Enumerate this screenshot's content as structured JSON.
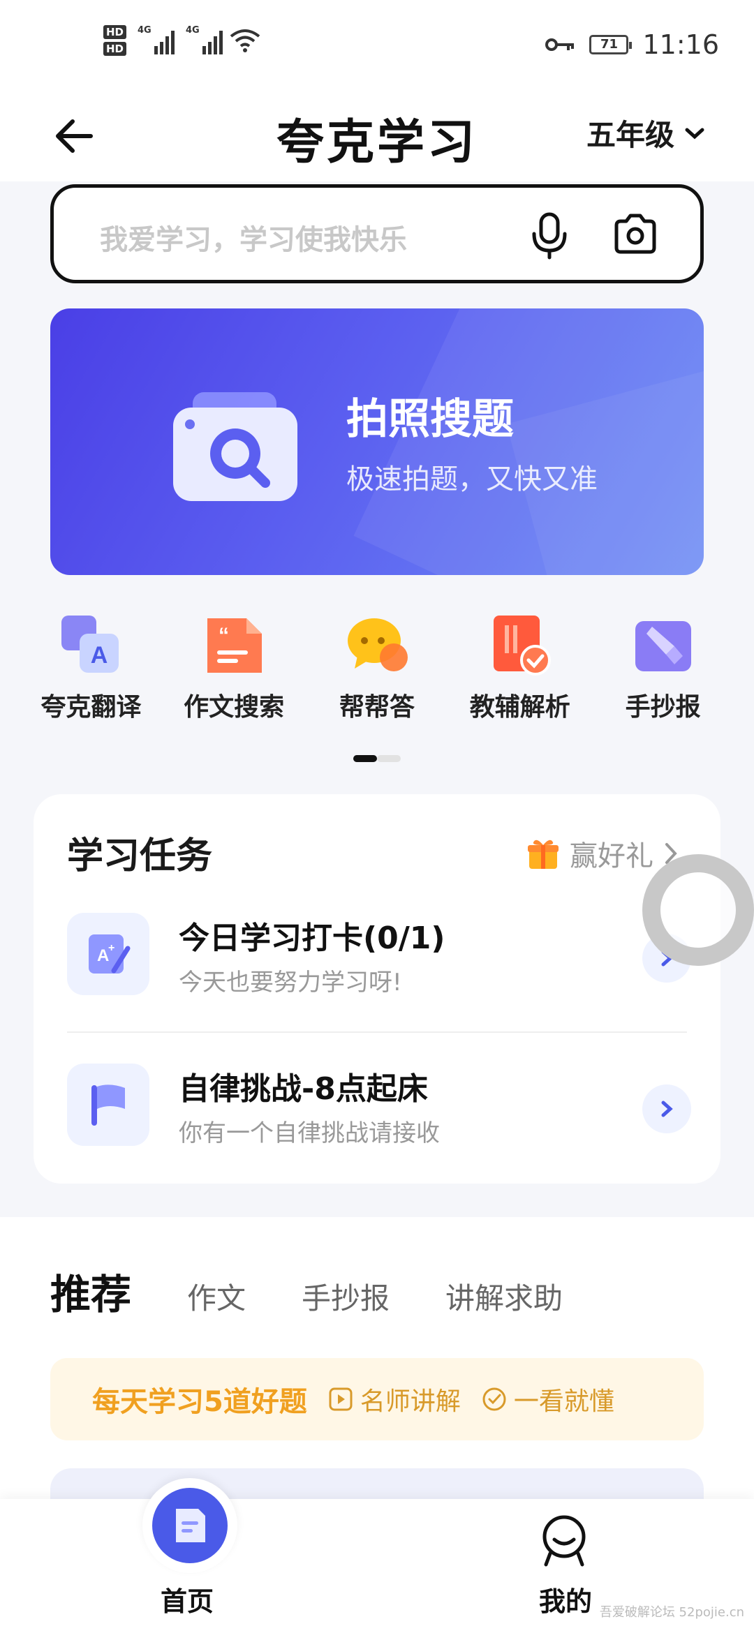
{
  "status_bar": {
    "hd1": "HD",
    "hd2": "HD",
    "net1": "4G",
    "net2": "4G",
    "battery": "71",
    "time": "11:16"
  },
  "header": {
    "title": "夸克学习",
    "grade": "五年级"
  },
  "search": {
    "placeholder": "我爱学习，学习使我快乐"
  },
  "banner": {
    "title": "拍照搜题",
    "subtitle": "极速拍题，又快又准"
  },
  "quick_tools": [
    {
      "label": "夸克翻译",
      "icon": "translate-icon",
      "color": "#7b7ff0"
    },
    {
      "label": "作文搜索",
      "icon": "essay-icon",
      "color": "#ff7a50"
    },
    {
      "label": "帮帮答",
      "icon": "chat-bubble-icon",
      "color": "#ffc21a"
    },
    {
      "label": "教辅解析",
      "icon": "book-check-icon",
      "color": "#ff5a3c"
    },
    {
      "label": "手抄报",
      "icon": "brush-icon",
      "color": "#8a7cf5"
    }
  ],
  "page_indicator": {
    "active_color": "#111111",
    "inactive_color": "#e0e0e0"
  },
  "tasks": {
    "title": "学习任务",
    "reward": "赢好礼",
    "items": [
      {
        "title": "今日学习打卡(0/1)",
        "subtitle": "今天也要努力学习呀!"
      },
      {
        "title": "自律挑战-8点起床",
        "subtitle": "你有一个自律挑战请接收"
      }
    ]
  },
  "recommend": {
    "title": "推荐",
    "tabs": [
      "作文",
      "手抄报",
      "讲解求助"
    ],
    "daily": {
      "main": "每天学习5道好题",
      "tag1": "名师讲解",
      "tag2": "一看就懂"
    }
  },
  "bottom_nav": {
    "home": "首页",
    "me": "我的"
  },
  "colors": {
    "brand": "#4a5ae8",
    "accent_orange": "#f0a020"
  },
  "watermark": "吾爱破解论坛 52pojie.cn"
}
